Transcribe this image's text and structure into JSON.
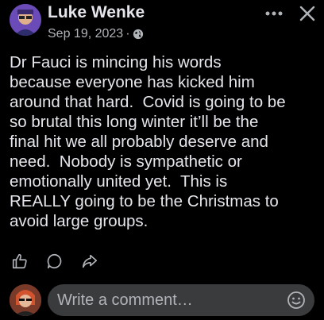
{
  "post": {
    "author": "Luke Wenke",
    "date": "Sep 19, 2023",
    "separator": "·",
    "privacy_icon": "globe-icon",
    "text": "Dr Fauci is mincing his words\nbecause everyone has kicked him\naround that hard.  Covid is going to be\nso brutal this long winter it’ll be the\nfinal hit we all probably deserve and\nneed.  Nobody is sympathetic or\nemotionally united yet.  This is\nREALLY going to be the Christmas to\navoid large groups."
  },
  "header": {
    "more_icon": "more-options-icon",
    "close_icon": "close-icon"
  },
  "actions": {
    "like_icon": "like-icon",
    "comment_icon": "comment-icon",
    "share_icon": "share-icon"
  },
  "comment": {
    "placeholder": "Write a comment…",
    "emoji_icon": "emoji-icon"
  },
  "colors": {
    "background": "#000000",
    "text": "#e4e6eb",
    "secondary_text": "#b0b3b8",
    "input_bg": "#3a3b3c"
  }
}
